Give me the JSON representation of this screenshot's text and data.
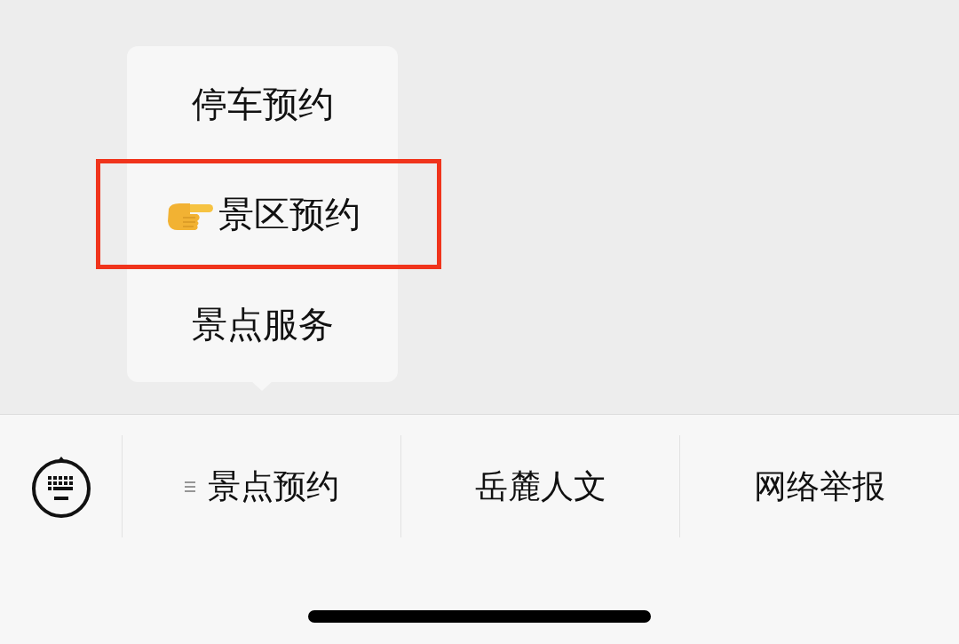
{
  "menu": {
    "items": [
      {
        "label": "停车预约",
        "pointer": false,
        "highlighted": false
      },
      {
        "label": "景区预约",
        "pointer": true,
        "highlighted": true
      },
      {
        "label": "景点服务",
        "pointer": false,
        "highlighted": false
      }
    ]
  },
  "tabs": [
    {
      "label": "景点预约",
      "submenu": true
    },
    {
      "label": "岳麓人文",
      "submenu": false
    },
    {
      "label": "网络举报",
      "submenu": false
    }
  ]
}
